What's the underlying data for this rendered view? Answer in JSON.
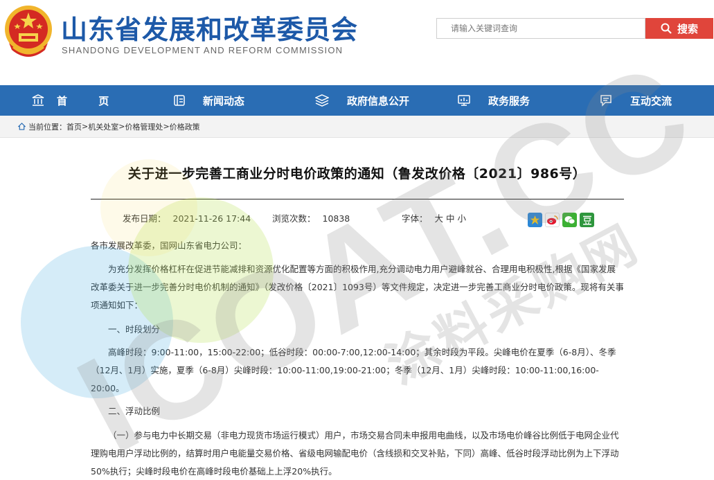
{
  "header": {
    "title": "山东省发展和改革委员会",
    "subtitle": "SHANDONG DEVELOPMENT AND REFORM COMMISSION",
    "search_placeholder": "请输入关键词查询",
    "search_button": "搜索",
    "accent_color": "#1d59a8",
    "search_color": "#e0453b"
  },
  "nav": {
    "color": "#2a6db4",
    "items": [
      {
        "label": "首 页",
        "icon": "bank-icon"
      },
      {
        "label": "新闻动态",
        "icon": "news-icon"
      },
      {
        "label": "政府信息公开",
        "icon": "layers-icon"
      },
      {
        "label": "政务服务",
        "icon": "monitor-icon"
      },
      {
        "label": "互动交流",
        "icon": "chat-icon"
      }
    ]
  },
  "breadcrumb": {
    "prefix": "当前位置：",
    "items": [
      "首页",
      "机关处室",
      "价格管理处",
      "价格政策"
    ],
    "separator": "> "
  },
  "article": {
    "title": "关于进一步完善工商业分时电价政策的通知（鲁发改价格〔2021〕986号）",
    "publish_label": "发布日期：",
    "publish_date": "2021-11-26 17:44",
    "views_label": "浏览次数：",
    "views": "10838",
    "font_label": "字体：",
    "font_sizes": [
      "大",
      "中",
      "小"
    ],
    "share_icons": [
      "qzone-icon",
      "weibo-icon",
      "wechat-icon",
      "douban-icon"
    ],
    "salutation": "各市发展改革委，国网山东省电力公司：",
    "intro": "为充分发挥价格杠杆在促进节能减排和资源优化配置等方面的积极作用,充分调动电力用户避峰就谷、合理用电积极性,根据《国家发展改革委关于进一步完善分时电价机制的通知》（发改价格〔2021〕1093号）等文件规定，决定进一步完善工商业分时电价政策。现将有关事项通知如下：",
    "section1_heading": "一、时段划分",
    "section1_body": "高峰时段：9:00-11:00，15:00-22:00；低谷时段：00:00-7:00,12:00-14:00；其余时段为平段。尖峰电价在夏季（6-8月）、冬季（12月、1月）实施，夏季（6-8月）尖峰时段：10:00-11:00,19:00-21:00；冬季（12月、1月）尖峰时段：10:00-11:00,16:00-20:00。",
    "section2_heading": "二、浮动比例",
    "section2_body": "（一）参与电力中长期交易（非电力现货市场运行模式）用户，市场交易合同未申报用电曲线，以及市场电价峰谷比例低于电网企业代理购电用户浮动比例的，结算时用户电能量交易价格、省级电网输配电价（含线损和交叉补贴，下同）高峰、低谷时段浮动比例为上下浮动50%执行；尖峰时段电价在高峰时段电价基础上上浮20%执行。"
  },
  "watermark": {
    "brand": "ICOAT.CC",
    "text": "涂料采购网"
  }
}
